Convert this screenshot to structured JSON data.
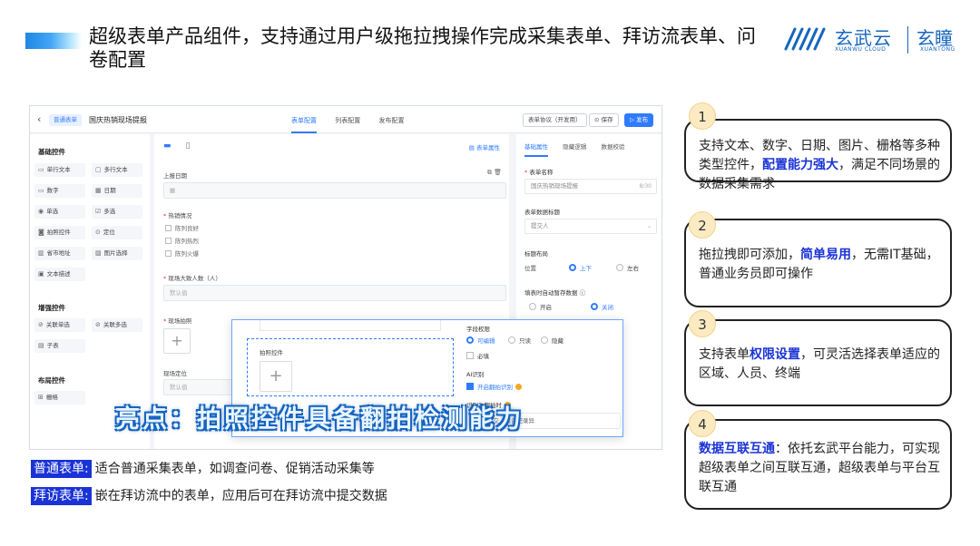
{
  "slide": {
    "title": "超级表单产品组件，支持通过用户级拖拉拽操作完成采集表单、拜访流表单、问卷配置",
    "logo_cn": "玄武云",
    "logo_en": "XUANWU CLOUD",
    "logo2_cn": "玄瞳",
    "logo2_en": "XUANTONG"
  },
  "app": {
    "tag": "普通表单",
    "form_title": "国庆热销现场提报",
    "tabs": [
      "表单配置",
      "列表配置",
      "发布配置"
    ],
    "btn_protocol": "表单协议（开发用）",
    "btn_save": "保存",
    "btn_publish": "发布",
    "left": {
      "basic_title": "基础控件",
      "basic": [
        "单行文本",
        "多行文本",
        "数字",
        "日期",
        "单选",
        "多选",
        "拍照控件",
        "定位",
        "省市地址",
        "图片选择",
        "文本描述"
      ],
      "enhanced_title": "增强控件",
      "enhanced": [
        "关联单选",
        "关联多选",
        "子表"
      ],
      "layout_title": "布局控件",
      "layout": [
        "栅格"
      ]
    },
    "canvas": {
      "form_attr": "表单属性",
      "field1_label": "上报日期",
      "field2_label": "热销情况",
      "field2_opts": [
        "陈列良好",
        "陈列热烈",
        "陈列火爆"
      ],
      "field3_label": "现场大致人数（人）",
      "field3_placeholder": "默认值",
      "field4_label": "现场拍照",
      "field5_label": "现场定位",
      "field5_placeholder": "默认值"
    },
    "right": {
      "tabs": [
        "基础属性",
        "隐藏逻辑",
        "数据校验"
      ],
      "name_label": "表单名称",
      "name_value": "国庆热销现场提报",
      "name_count": "8/30",
      "data_title_label": "表单数据标题",
      "data_title_value": "提交人",
      "layout_label": "标题布局",
      "position_label": "位置",
      "pos_top": "上下",
      "pos_left": "左右",
      "autosave_label": "填表时自动暂存数据",
      "on": "开启",
      "off": "关闭"
    },
    "popup": {
      "control_label": "拍照控件",
      "perm_label": "字段权限",
      "perm_opts": [
        "可编辑",
        "只读",
        "隐藏"
      ],
      "required": "必填",
      "ai_label": "AI识别",
      "ai_flip": "开启翻拍识别",
      "flip_label": "识别为翻拍时",
      "flip_value": "允许提交，后台记录异"
    },
    "highlight": "亮点：拍照控件具备翻拍检测能力"
  },
  "notes": [
    {
      "key": "普通表单:",
      "text": "适合普通采集表单，如调查问卷、促销活动采集等"
    },
    {
      "key": "拜访表单:",
      "text": "嵌在拜访流中的表单，应用后可在拜访流中提交数据"
    }
  ],
  "cards": [
    {
      "num": "1",
      "pre": "支持文本、数字、日期、图片、栅格等多种类型控件，",
      "hl": "配置能力强大",
      "post": "，满足不同场景的数据采集需求"
    },
    {
      "num": "2",
      "pre": "拖拉拽即可添加，",
      "hl": "简单易用",
      "post": "，无需IT基础，普通业务员即可操作"
    },
    {
      "num": "3",
      "pre": "支持表单",
      "hl": "权限设置",
      "post": "，可灵活选择表单适应的区域、人员、终端"
    },
    {
      "num": "4",
      "pre": "",
      "hl": "数据互联互通",
      "post": "：依托玄武平台能力，可实现超级表单之间互联互通，超级表单与平台互联互通"
    }
  ],
  "colors": {
    "accent": "#1a33d6",
    "app_blue": "#2f7bff",
    "badge": "#fcebc2"
  }
}
